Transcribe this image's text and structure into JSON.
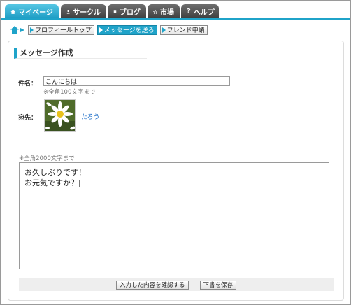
{
  "tabs": [
    {
      "label": "マイページ",
      "icon": "house-icon",
      "active": true
    },
    {
      "label": "サークル",
      "icon": "person-icon",
      "active": false
    },
    {
      "label": "ブログ",
      "icon": "square-icon",
      "active": false
    },
    {
      "label": "市場",
      "icon": "star-icon",
      "active": false
    },
    {
      "label": "ヘルプ",
      "icon": "question-icon",
      "active": false
    }
  ],
  "subnav": {
    "items": [
      {
        "label": "プロフィールトップ",
        "active": false
      },
      {
        "label": "メッセージを送る",
        "active": true
      },
      {
        "label": "フレンド申請",
        "active": false
      }
    ]
  },
  "form": {
    "title": "メッセージ作成",
    "subject_label": "件名：",
    "subject_value": "こんにちは",
    "subject_note": "※全角100文字まで",
    "to_label": "宛先：",
    "recipient_name": "たろう",
    "body_note": "※全角2000文字まで",
    "body_value": "お久しぶりです！\nお元気ですか？|",
    "confirm_button": "入力した内容を確認する",
    "draft_button": "下書を保存"
  },
  "colors": {
    "accent": "#1fa3c9",
    "tab_inactive": "#4a4a4a",
    "link": "#1f6fc9"
  }
}
